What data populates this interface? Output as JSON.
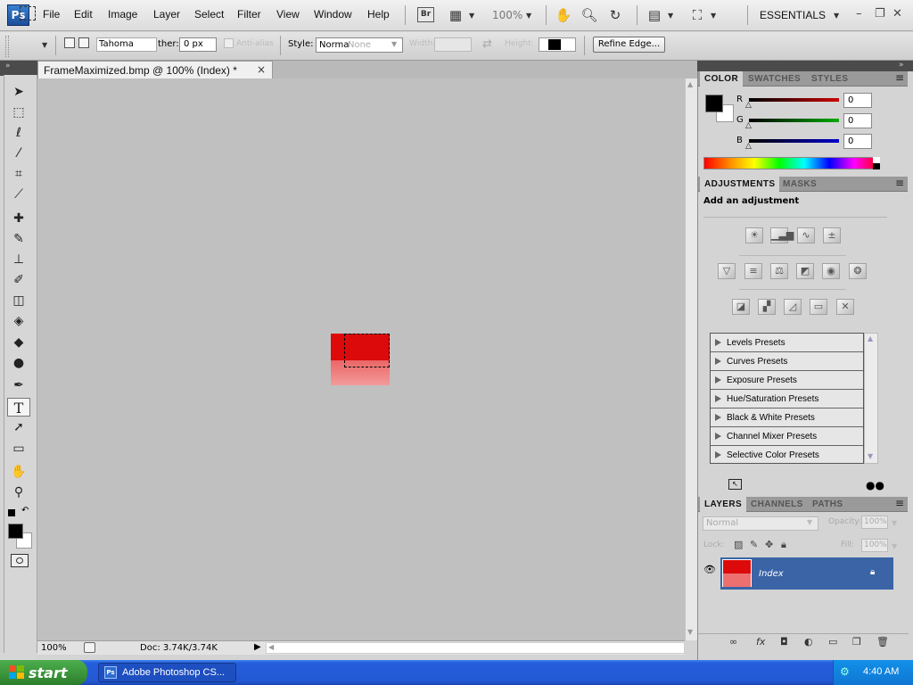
{
  "app": {
    "logo": "Ps",
    "workspace": "ESSENTIALS",
    "bridge_label": "Br"
  },
  "menu": [
    "File",
    "Edit",
    "Image",
    "Layer",
    "Select",
    "Filter",
    "View",
    "Window",
    "Help"
  ],
  "toolbar_top": {
    "zoom": "100%",
    "icons": [
      "launch-mini-bridge-icon",
      "hand-icon",
      "zoom-icon",
      "rotate-view-icon",
      "arrange-documents-icon",
      "screen-mode-icon"
    ]
  },
  "options": {
    "font_field": "Tahoma",
    "feather_label": "ther:",
    "feather_value": "0 px",
    "antialias_label": "Anti-alias",
    "style_label": "Style:",
    "style_value": "Norma",
    "style_ghost": "None",
    "width_label": "Width:",
    "height_label": "Height:",
    "refine_edge": "Refine Edge..."
  },
  "document": {
    "tab_title": "FrameMaximized.bmp @ 100% (Index) *",
    "close": "×",
    "status_zoom": "100%",
    "status_doc": "Doc: 3.74K/3.74K",
    "image_top_color": "#dc0a0a",
    "image_bottom_color": "#ec7070"
  },
  "tools": [
    "move-tool",
    "marquee-tool",
    "lasso-tool",
    "quick-selection-tool",
    "crop-tool",
    "eyedropper-tool",
    "healing-brush-tool",
    "brush-tool",
    "clone-stamp-tool",
    "history-brush-tool",
    "eraser-tool",
    "paint-bucket-tool",
    "blur-tool",
    "dodge-tool",
    "pen-tool",
    "type-tool",
    "path-selection-tool",
    "rectangle-tool",
    "hand-tool",
    "zoom-tool"
  ],
  "active_tool": "type-tool",
  "color_panel": {
    "tabs": [
      "COLOR",
      "SWATCHES",
      "STYLES"
    ],
    "sliders": [
      {
        "label": "R",
        "value": "0",
        "color": "#cc0000"
      },
      {
        "label": "G",
        "value": "0",
        "color": "#00aa00"
      },
      {
        "label": "B",
        "value": "0",
        "color": "#0000cc"
      }
    ],
    "foreground": "#000000",
    "background": "#ffffff"
  },
  "adjustments_panel": {
    "tabs": [
      "ADJUSTMENTS",
      "MASKS"
    ],
    "title": "Add an adjustment",
    "icon_rows": [
      [
        "brightness-contrast-icon",
        "levels-icon",
        "curves-icon",
        "exposure-icon"
      ],
      [
        "vibrance-icon",
        "hue-saturation-icon",
        "color-balance-icon",
        "black-white-icon",
        "photo-filter-icon",
        "channel-mixer-icon"
      ],
      [
        "invert-icon",
        "posterize-icon",
        "threshold-icon",
        "gradient-map-icon",
        "selective-color-icon"
      ]
    ],
    "presets": [
      "Levels Presets",
      "Curves Presets",
      "Exposure Presets",
      "Hue/Saturation Presets",
      "Black & White Presets",
      "Channel Mixer Presets",
      "Selective Color Presets"
    ]
  },
  "layers_panel": {
    "tabs": [
      "LAYERS",
      "CHANNELS",
      "PATHS"
    ],
    "blend_mode": "Normal",
    "opacity_label": "Opacity:",
    "opacity": "100%",
    "lock_label": "Lock:",
    "fill_label": "Fill:",
    "fill": "100%",
    "layer_name": "Index"
  },
  "taskbar": {
    "start": "start",
    "task": "Adobe Photoshop CS...",
    "clock": "4:40 AM"
  }
}
